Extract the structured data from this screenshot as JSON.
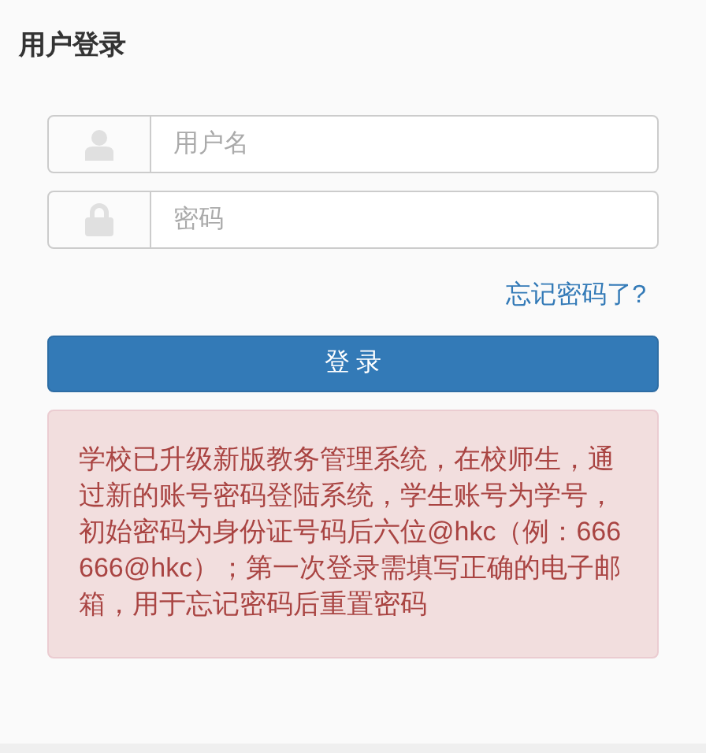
{
  "title": "用户登录",
  "fields": [
    {
      "kind": "user",
      "placeholder": "用户名"
    },
    {
      "kind": "password",
      "placeholder": "密码"
    }
  ],
  "forgot_link": "忘记密码了?",
  "login_button": "登 录",
  "notice": "学校已升级新版教务管理系统，在校师生，通过新的账号密码登陆系统，学生账号为学号，初始密码为身份证号码后六位@hkc（例：666666@hkc）；第一次登录需填写正确的电子邮箱，用于忘记密码后重置密码"
}
